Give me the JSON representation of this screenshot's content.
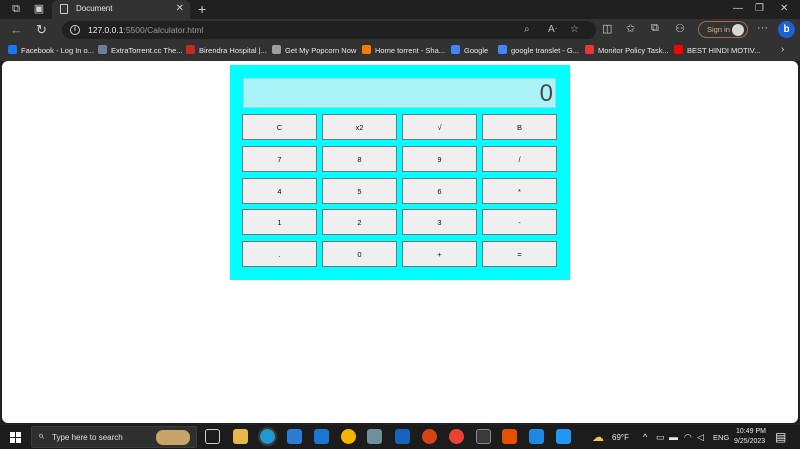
{
  "browser": {
    "tab_title": "Document",
    "url_host": "127.0.0.1",
    "url_rest": ":5500/Calculator.html",
    "signin_label": "Sign in",
    "bing_label": "b",
    "bookmarks": [
      {
        "label": "Facebook - Log In o...",
        "color": "#1877f2"
      },
      {
        "label": "ExtraTorrent.cc The...",
        "color": "#6b7fa3"
      },
      {
        "label": "Birendra Hospital |...",
        "color": "#c62828"
      },
      {
        "label": "Get My Popcorn Now",
        "color": "#9e9e9e"
      },
      {
        "label": "Home torrent - Sha...",
        "color": "#f57c00"
      },
      {
        "label": "Google",
        "color": "#4285f4"
      },
      {
        "label": "google translet - G...",
        "color": "#4285f4"
      },
      {
        "label": "Monitor Policy Task...",
        "color": "#e53935"
      },
      {
        "label": "BEST HINDI MOTIV...",
        "color": "#ff0000"
      }
    ]
  },
  "calculator": {
    "display_value": "0",
    "keys": [
      [
        "C",
        "x2",
        "√",
        "B"
      ],
      [
        "7",
        "8",
        "9",
        "/"
      ],
      [
        "4",
        "5",
        "6",
        "*"
      ],
      [
        "1",
        "2",
        "3",
        "-"
      ],
      [
        ".",
        "0",
        "+",
        "="
      ]
    ]
  },
  "taskbar": {
    "search_placeholder": "Type here to search",
    "temperature": "69°F",
    "language": "ENG",
    "time": "10:49 PM",
    "date": "9/25/2023"
  }
}
